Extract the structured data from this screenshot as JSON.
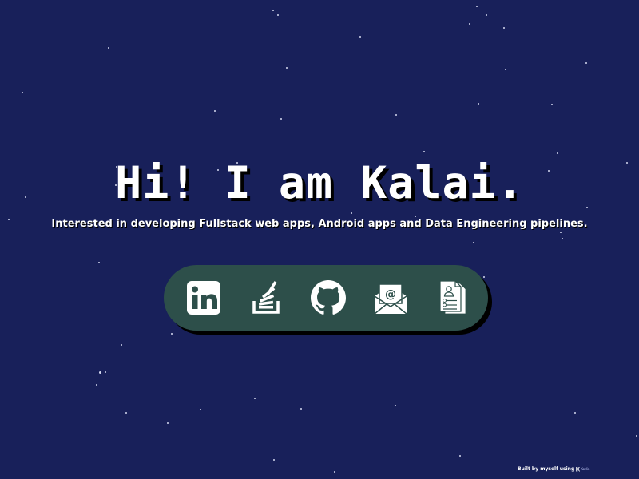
{
  "hero": {
    "title": "Hi! I am Kalai.",
    "subtitle": "Interested in developing Fullstack web apps, Android apps and Data Engineering pipelines."
  },
  "links": [
    {
      "name": "linkedin",
      "icon": "linkedin-icon"
    },
    {
      "name": "stackoverflow",
      "icon": "stackoverflow-icon"
    },
    {
      "name": "github",
      "icon": "github-icon"
    },
    {
      "name": "email",
      "icon": "envelope-icon"
    },
    {
      "name": "resume",
      "icon": "resume-icon"
    }
  ],
  "footer": {
    "built_text": "Built by myself using",
    "logo_text": "Kotlin"
  },
  "colors": {
    "background": "#18205a",
    "dock": "#2d4f4a",
    "icon": "#ffffff",
    "text": "#ffffff"
  }
}
